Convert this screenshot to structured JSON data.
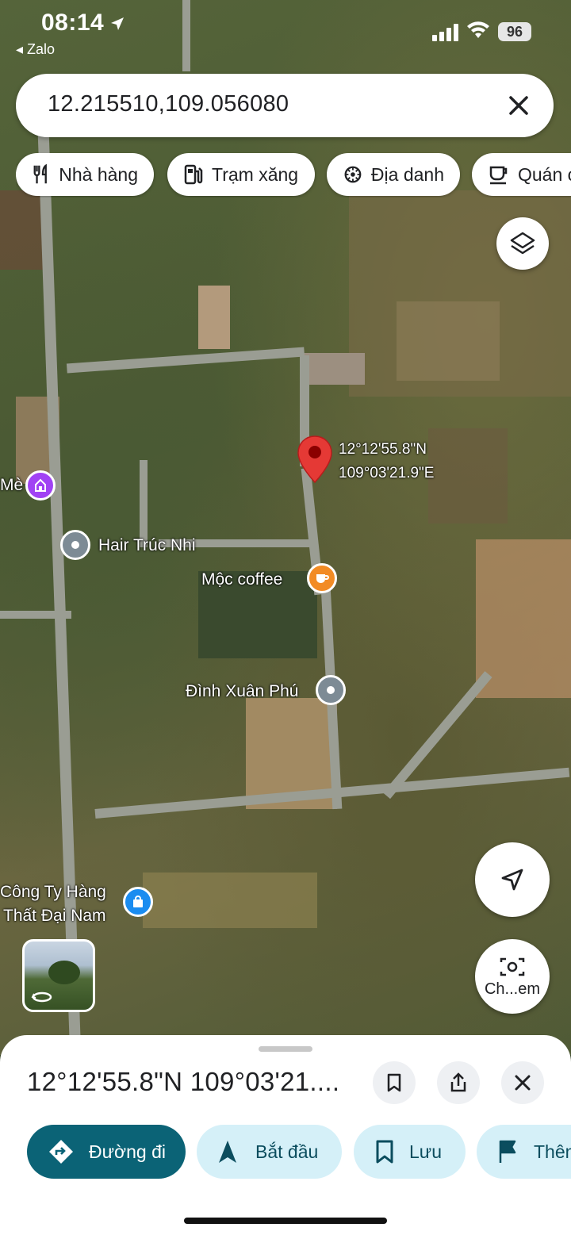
{
  "status_bar": {
    "time": "08:14",
    "back_app": "Zalo",
    "battery": "96"
  },
  "search": {
    "value": "12.215510,109.056080"
  },
  "chips": [
    {
      "label": "Nhà hàng",
      "icon": "restaurant-icon"
    },
    {
      "label": "Trạm xăng",
      "icon": "gas-station-icon"
    },
    {
      "label": "Địa danh",
      "icon": "landmark-icon"
    },
    {
      "label": "Quán c",
      "icon": "cafe-icon"
    }
  ],
  "map": {
    "pin_lat": "12°12'55.8\"N",
    "pin_lng": "109°03'21.9\"E",
    "labels": {
      "me": "Mè",
      "hair": "Hair Trúc Nhi",
      "coffee": "Mộc coffee",
      "dinh": "Đình Xuân Phú",
      "company_line1": "Công Ty Hàng",
      "company_line2": "Thất Đại Nam"
    },
    "camera_label": "Ch...em"
  },
  "sheet": {
    "title": "12°12'55.8\"N 109°03'21....",
    "actions": [
      {
        "label": "Đường đi",
        "icon": "directions-icon"
      },
      {
        "label": "Bắt đầu",
        "icon": "navigate-icon"
      },
      {
        "label": "Lưu",
        "icon": "bookmark-icon"
      },
      {
        "label": "Thêm",
        "icon": "flag-icon"
      }
    ]
  },
  "colors": {
    "primary": "#0b6376",
    "chip_light": "#d5f0f8",
    "pin": "#e53935",
    "coffee": "#f28b24",
    "poi_gray": "#7d8b95",
    "shopping": "#1a8cf0",
    "purple": "#a142f4"
  }
}
